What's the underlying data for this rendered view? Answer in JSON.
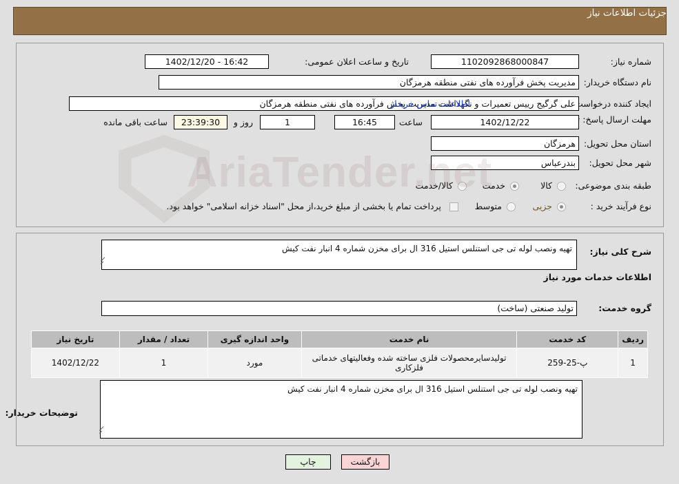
{
  "header": {
    "title": "جزئیات اطلاعات نیاز"
  },
  "watermark": {
    "text": "AriaTender.net"
  },
  "top_panel": {
    "need_number": {
      "label": "شماره نیاز:",
      "value": "1102092868000847"
    },
    "announce_datetime": {
      "label": "تاریخ و ساعت اعلان عمومی:",
      "value": "16:42 - 1402/12/20"
    },
    "buyer_org": {
      "label": "نام دستگاه خریدار:",
      "value": "مدیریت پخش فرآورده های نفتی منطقه هرمزگان"
    },
    "requester": {
      "label": "ایجاد کننده درخواست:",
      "value": "علی گرگیج رییس تعمیرات و نگهداشت مدیریت پخش فرآورده های نفتی منطقه هرمزگان"
    },
    "buyer_contact_link": "اطلاعات تماس خریدار",
    "deadline": {
      "label": "مهلت ارسال پاسخ: تا تاریخ:",
      "date": "1402/12/22",
      "hour_label": "ساعت",
      "hour": "16:45",
      "days": "1",
      "days_label": "روز و",
      "countdown": "23:39:30",
      "remaining_label": "ساعت باقی مانده"
    },
    "delivery_province": {
      "label": "استان محل تحویل:",
      "value": "هرمزگان"
    },
    "delivery_city": {
      "label": "شهر محل تحویل:",
      "value": "بندرعباس"
    },
    "subject_class": {
      "label": "طبقه بندی موضوعی:",
      "options": [
        "کالا",
        "خدمت",
        "کالا/خدمت"
      ],
      "selected": "خدمت"
    },
    "purchase_process": {
      "label": "نوع فرآیند خرید :",
      "options": [
        "جزیی",
        "متوسط"
      ],
      "selected": "جزیی"
    },
    "treasury_note": "پرداخت تمام یا بخشی از مبلغ خرید،از محل \"اسناد خزانه اسلامی\" خواهد بود."
  },
  "mid_panel": {
    "general_desc": {
      "label": "شرح کلی نیاز:",
      "value": "تهیه ونصب لوله تی جی استنلس استیل 316 ال برای مخزن شماره 4 انبار نفت کیش"
    },
    "services_section_title": "اطلاعات خدمات مورد نیاز",
    "service_group": {
      "label": "گروه خدمت:",
      "value": "تولید صنعتی (ساخت)"
    },
    "table": {
      "headers": [
        "ردیف",
        "کد خدمت",
        "نام خدمت",
        "واحد اندازه گیری",
        "تعداد / مقدار",
        "تاریخ نیاز"
      ],
      "rows": [
        {
          "radif": "1",
          "code": "پ-25-259",
          "name": "تولیدسایرمحصولات فلزی ساخته شده وفعالیتهای خدماتی فلزکاری",
          "unit": "مورد",
          "qty": "1",
          "date": "1402/12/22"
        }
      ]
    },
    "buyer_notes": {
      "label": "توضیحات خریدار:",
      "value": "تهیه ونصب لوله تی جی استنلس استیل 316 ال برای مخزن شماره 4 انبار نفت کیش"
    }
  },
  "footer": {
    "print_label": "چاپ",
    "back_label": "بازگشت"
  }
}
